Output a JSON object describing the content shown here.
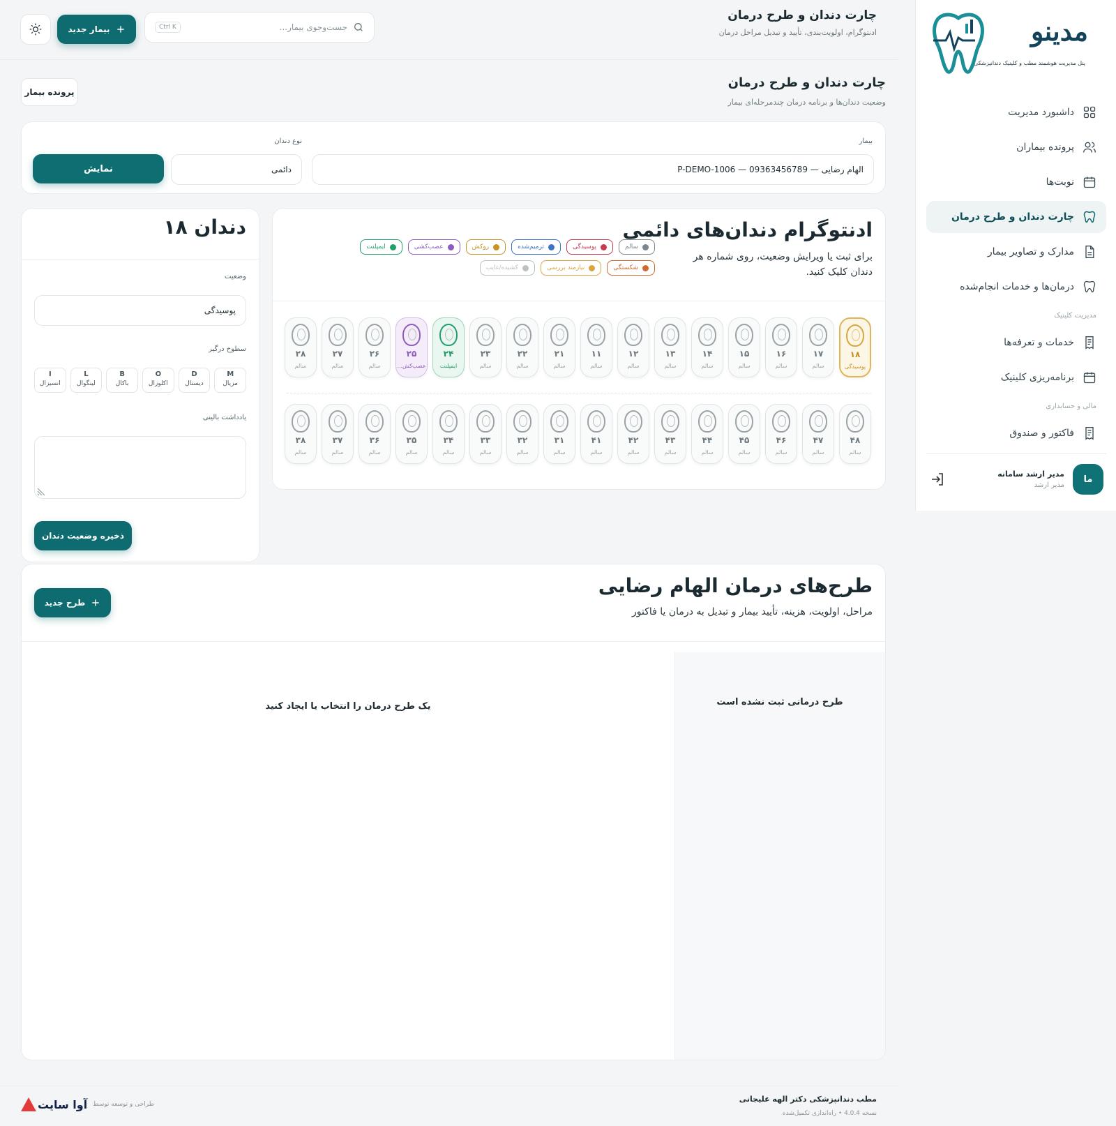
{
  "brand": {
    "name": "مدینو",
    "tagline": "پنل مدیریت هوشمند مطب و کلینیک دندانپزشکی",
    "accent": "#0e6b6f"
  },
  "sidebar": {
    "items": [
      {
        "label": "داشبورد مدیریت",
        "icon": "dashboard-icon"
      },
      {
        "label": "پرونده بیماران",
        "icon": "users-icon"
      },
      {
        "label": "نوبت‌ها",
        "icon": "calendar-icon"
      },
      {
        "label": "چارت دندان و طرح درمان",
        "icon": "tooth-icon",
        "active": true
      },
      {
        "label": "مدارک و تصاویر بیمار",
        "icon": "document-icon"
      },
      {
        "label": "درمان‌ها و خدمات انجام‌شده",
        "icon": "tooth-icon"
      }
    ],
    "section_clinic": "مدیریت کلینیک",
    "clinic_items": [
      {
        "label": "خدمات و تعرفه‌ها",
        "icon": "receipt-icon"
      },
      {
        "label": "برنامه‌ریزی کلینیک",
        "icon": "calendar-icon"
      }
    ],
    "section_finance": "مالی و حسابداری",
    "finance_items": [
      {
        "label": "فاکتور و صندوق",
        "icon": "receipt-icon"
      }
    ],
    "user": {
      "initials": "ما",
      "name": "مدیر ارشد سامانه",
      "role": "مدیر ارشد"
    }
  },
  "topbar": {
    "title": "چارت دندان و طرح درمان",
    "subtitle": "ادنتوگرام، اولویت‌بندی، تأیید و تبدیل مراحل درمان",
    "search_placeholder": "جست‌وجوی بیمار...",
    "search_shortcut": "Ctrl K",
    "new_patient": "بیمار جدید"
  },
  "page": {
    "title": "چارت دندان و طرح درمان",
    "subtitle": "وضعیت دندان‌ها و برنامه درمان چندمرحله‌ای بیمار",
    "patient_file_button": "پرونده بیمار"
  },
  "filter": {
    "patient_label": "بیمار",
    "patient_value": "الهام رضایی — 09363456789 — P-DEMO-1006",
    "type_label": "نوع دندان",
    "type_value": "دائمی",
    "show_button": "نمایش"
  },
  "odontogram": {
    "title": "ادنتوگرام دندان‌های دائمی",
    "description": "برای ثبت یا ویرایش وضعیت، روی شماره هر دندان کلیک کنید.",
    "legend": [
      {
        "label": "سالم",
        "color": "#7b878c"
      },
      {
        "label": "پوسیدگی",
        "color": "#c63b4d"
      },
      {
        "label": "ترمیم‌شده",
        "color": "#3b74c4"
      },
      {
        "label": "روکش",
        "color": "#c89422"
      },
      {
        "label": "عصب‌کشی",
        "color": "#8e5bbf"
      },
      {
        "label": "ایمپلنت",
        "color": "#21a06a"
      },
      {
        "label": "شکستگی",
        "color": "#d06a2e"
      },
      {
        "label": "نیازمند بررسی",
        "color": "#d9a53c"
      },
      {
        "label": "کشیده/غایب",
        "color": "#b9c1c4"
      }
    ],
    "upper": [
      {
        "num": "۱۸",
        "status": "پوسیدگی",
        "kind": "sel"
      },
      {
        "num": "۱۷",
        "status": "سالم",
        "kind": ""
      },
      {
        "num": "۱۶",
        "status": "سالم",
        "kind": ""
      },
      {
        "num": "۱۵",
        "status": "سالم",
        "kind": ""
      },
      {
        "num": "۱۴",
        "status": "سالم",
        "kind": ""
      },
      {
        "num": "۱۳",
        "status": "سالم",
        "kind": ""
      },
      {
        "num": "۱۲",
        "status": "سالم",
        "kind": ""
      },
      {
        "num": "۱۱",
        "status": "سالم",
        "kind": ""
      },
      {
        "num": "۲۱",
        "status": "سالم",
        "kind": ""
      },
      {
        "num": "۲۲",
        "status": "سالم",
        "kind": ""
      },
      {
        "num": "۲۳",
        "status": "سالم",
        "kind": ""
      },
      {
        "num": "۲۴",
        "status": "ایمپلنت",
        "kind": "imp"
      },
      {
        "num": "۲۵",
        "status": "عصب‌کش...",
        "kind": "rct"
      },
      {
        "num": "۲۶",
        "status": "سالم",
        "kind": ""
      },
      {
        "num": "۲۷",
        "status": "سالم",
        "kind": ""
      },
      {
        "num": "۲۸",
        "status": "سالم",
        "kind": ""
      }
    ],
    "lower": [
      {
        "num": "۴۸",
        "status": "سالم",
        "kind": ""
      },
      {
        "num": "۴۷",
        "status": "سالم",
        "kind": ""
      },
      {
        "num": "۴۶",
        "status": "سالم",
        "kind": ""
      },
      {
        "num": "۴۵",
        "status": "سالم",
        "kind": ""
      },
      {
        "num": "۴۴",
        "status": "سالم",
        "kind": ""
      },
      {
        "num": "۴۳",
        "status": "سالم",
        "kind": ""
      },
      {
        "num": "۴۲",
        "status": "سالم",
        "kind": ""
      },
      {
        "num": "۴۱",
        "status": "سالم",
        "kind": ""
      },
      {
        "num": "۳۱",
        "status": "سالم",
        "kind": ""
      },
      {
        "num": "۳۲",
        "status": "سالم",
        "kind": ""
      },
      {
        "num": "۳۳",
        "status": "سالم",
        "kind": ""
      },
      {
        "num": "۳۴",
        "status": "سالم",
        "kind": ""
      },
      {
        "num": "۳۵",
        "status": "سالم",
        "kind": ""
      },
      {
        "num": "۳۶",
        "status": "سالم",
        "kind": ""
      },
      {
        "num": "۳۷",
        "status": "سالم",
        "kind": ""
      },
      {
        "num": "۳۸",
        "status": "سالم",
        "kind": ""
      }
    ]
  },
  "tooth_panel": {
    "title": "دندان ۱۸",
    "status_label": "وضعیت",
    "status_value": "پوسیدگی",
    "surfaces_label": "سطوح درگیر",
    "surfaces": [
      {
        "code": "M",
        "label": "مزیال"
      },
      {
        "code": "D",
        "label": "دیستال"
      },
      {
        "code": "O",
        "label": "اکلوزال"
      },
      {
        "code": "B",
        "label": "باکال"
      },
      {
        "code": "L",
        "label": "لینگوال"
      },
      {
        "code": "I",
        "label": "انسیزال"
      }
    ],
    "note_label": "یادداشت بالینی",
    "note_value": "",
    "save_button": "ذخیره وضعیت دندان"
  },
  "plans": {
    "title": "طرح‌های درمان الهام رضایی",
    "subtitle": "مراحل، اولویت، هزینه، تأیید بیمار و تبدیل به درمان یا فاکتور",
    "new_button": "طرح جدید",
    "empty_list": "طرح درمانی ثبت نشده است",
    "detail_placeholder": "یک طرح درمان را انتخاب یا ایجاد کنید"
  },
  "footer": {
    "clinic": "مطب دندانپزشکی دکتر الهه علیجانی",
    "version": "نسخه 4.0.4 • راه‌اندازی تکمیل‌شده",
    "credit": "طراحی و توسعه توسط",
    "company": "آوا سایت"
  }
}
